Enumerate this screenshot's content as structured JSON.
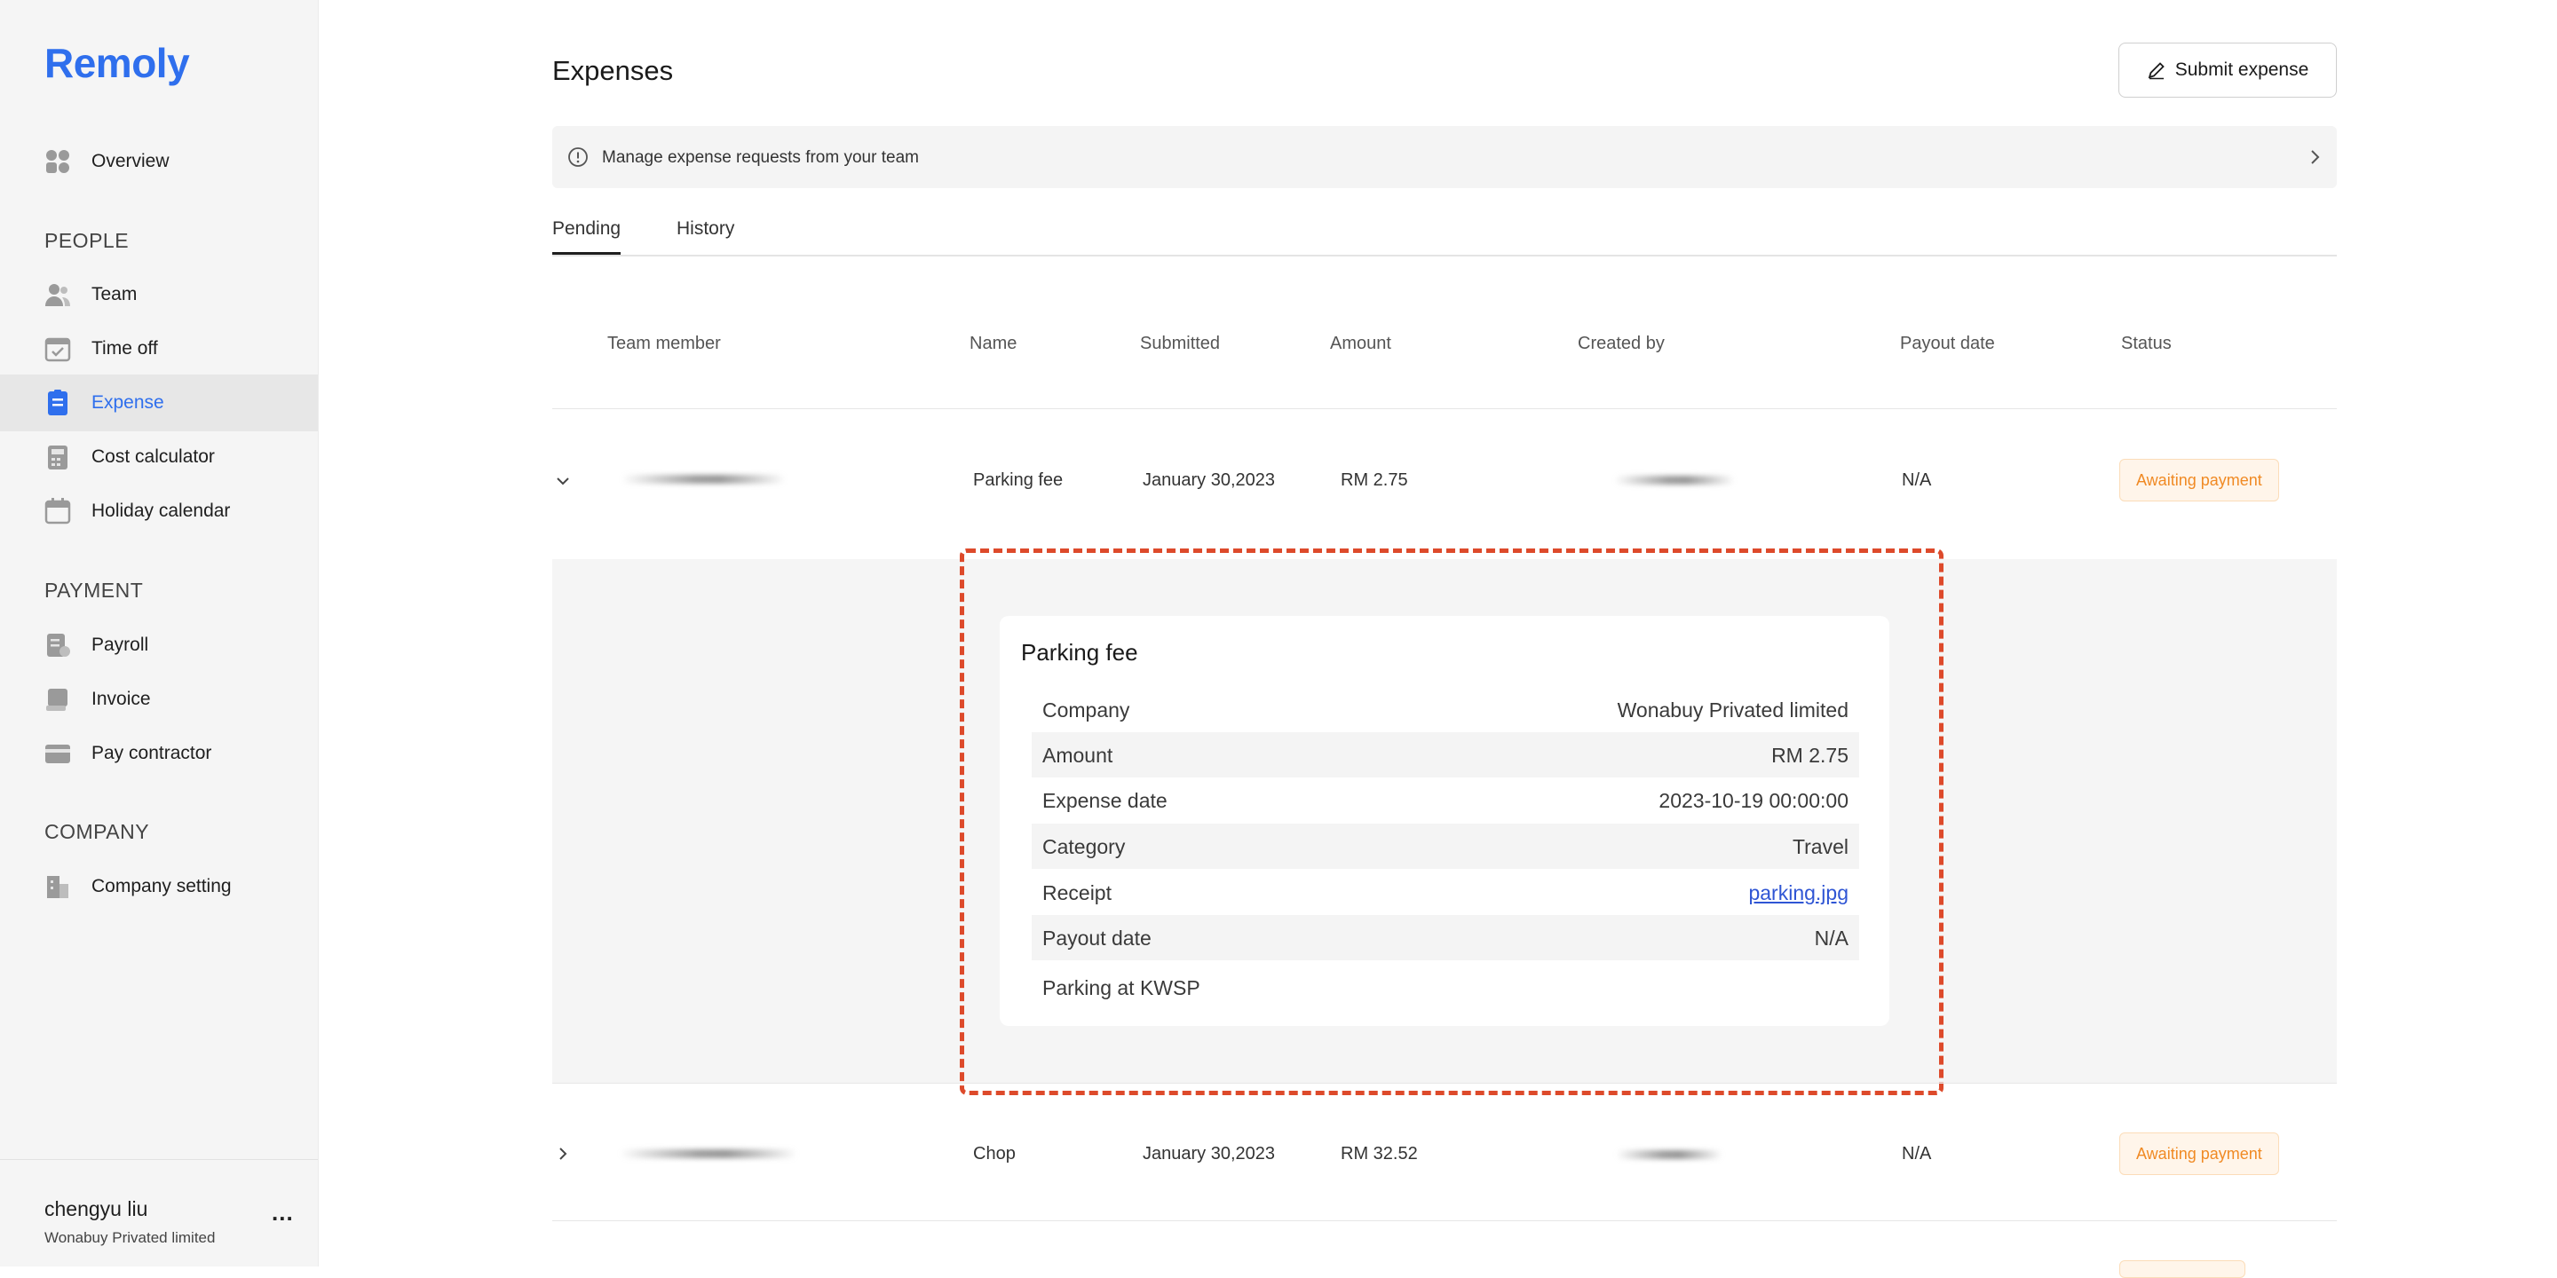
{
  "app": {
    "logo": "Remoly"
  },
  "sidebar": {
    "overview": "Overview",
    "sections": {
      "people": "PEOPLE",
      "payment": "PAYMENT",
      "company": "COMPANY"
    },
    "items": [
      {
        "label": "Team",
        "icon": "team-icon"
      },
      {
        "label": "Time off",
        "icon": "calendar-check-icon"
      },
      {
        "label": "Expense",
        "icon": "expense-icon"
      },
      {
        "label": "Cost calculator",
        "icon": "calculator-icon"
      },
      {
        "label": "Holiday calendar",
        "icon": "calendar-icon"
      },
      {
        "label": "Payroll",
        "icon": "payroll-icon"
      },
      {
        "label": "Invoice",
        "icon": "invoice-icon"
      },
      {
        "label": "Pay contractor",
        "icon": "card-icon"
      },
      {
        "label": "Company setting",
        "icon": "building-icon"
      }
    ],
    "user": {
      "name": "chengyu liu",
      "company": "Wonabuy Privated limited",
      "more": "..."
    },
    "accent": "#2f6fed"
  },
  "main": {
    "title": "Expenses",
    "submit_label": "Submit expense",
    "info_text": "Manage expense requests from your team",
    "tabs": [
      "Pending",
      "History"
    ],
    "columns": [
      "Team member",
      "Name",
      "Submitted",
      "Amount",
      "Created by",
      "Payout date",
      "Status"
    ],
    "rows": [
      {
        "name": "Parking fee",
        "submitted": "January 30,2023",
        "amount": "RM 2.75",
        "payout": "N/A",
        "status": "Awaiting payment"
      },
      {
        "name": "Chop",
        "submitted": "January 30,2023",
        "amount": "RM 32.52",
        "payout": "N/A",
        "status": "Awaiting payment"
      }
    ]
  },
  "detail": {
    "title": "Parking fee",
    "fields": [
      {
        "key": "Company",
        "value": "Wonabuy Privated limited"
      },
      {
        "key": "Amount",
        "value": "RM 2.75"
      },
      {
        "key": "Expense date",
        "value": "2023-10-19 00:00:00"
      },
      {
        "key": "Category",
        "value": "Travel"
      },
      {
        "key": "Receipt",
        "value": "parking.jpg"
      },
      {
        "key": "Payout date",
        "value": "N/A"
      }
    ],
    "note": "Parking at KWSP"
  },
  "colors": {
    "status": "#f08a24",
    "highlight": "#dd4a2b",
    "link": "#2f55d4"
  }
}
